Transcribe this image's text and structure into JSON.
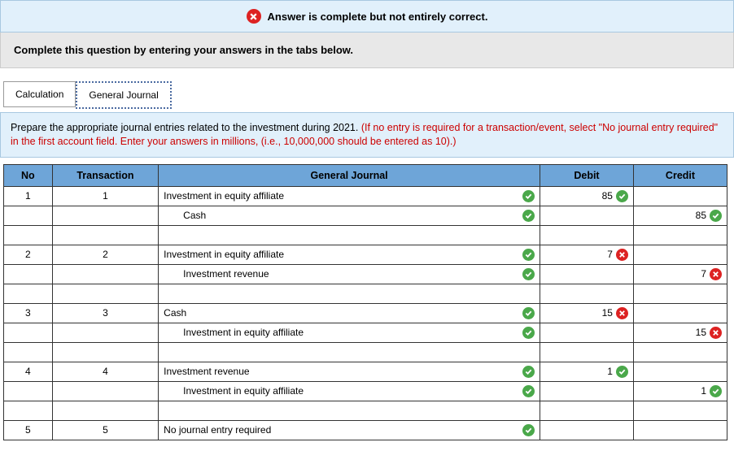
{
  "banner_text": "Answer is complete but not entirely correct.",
  "instruction": "Complete this question by entering your answers in the tabs below.",
  "tabs": {
    "calc": "Calculation",
    "gj": "General\nJournal"
  },
  "prompt_lead": "Prepare the appropriate journal entries related to the investment during 2021. ",
  "prompt_red": "(If no entry is required for a transaction/event, select \"No journal entry required\" in the first account field. Enter your answers in millions, (i.e., 10,000,000 should be entered as 10).)",
  "headers": {
    "no": "No",
    "txn": "Transaction",
    "gj": "General Journal",
    "debit": "Debit",
    "credit": "Credit"
  },
  "rows": [
    {
      "no": "1",
      "txn": "1",
      "acct": "Investment in equity affiliate",
      "indent": false,
      "acct_ok": true,
      "debit": "85",
      "debit_ok": true,
      "credit": "",
      "credit_ok": null
    },
    {
      "no": "",
      "txn": "",
      "acct": "Cash",
      "indent": true,
      "acct_ok": true,
      "debit": "",
      "debit_ok": null,
      "credit": "85",
      "credit_ok": true
    },
    {
      "spacer": true
    },
    {
      "no": "2",
      "txn": "2",
      "acct": "Investment in equity affiliate",
      "indent": false,
      "acct_ok": true,
      "debit": "7",
      "debit_ok": false,
      "credit": "",
      "credit_ok": null
    },
    {
      "no": "",
      "txn": "",
      "acct": "Investment revenue",
      "indent": true,
      "acct_ok": true,
      "debit": "",
      "debit_ok": null,
      "credit": "7",
      "credit_ok": false
    },
    {
      "spacer": true
    },
    {
      "no": "3",
      "txn": "3",
      "acct": "Cash",
      "indent": false,
      "acct_ok": true,
      "debit": "15",
      "debit_ok": false,
      "credit": "",
      "credit_ok": null
    },
    {
      "no": "",
      "txn": "",
      "acct": "Investment in equity affiliate",
      "indent": true,
      "acct_ok": true,
      "debit": "",
      "debit_ok": null,
      "credit": "15",
      "credit_ok": false
    },
    {
      "spacer": true
    },
    {
      "no": "4",
      "txn": "4",
      "acct": "Investment revenue",
      "indent": false,
      "acct_ok": true,
      "debit": "1",
      "debit_ok": true,
      "credit": "",
      "credit_ok": null
    },
    {
      "no": "",
      "txn": "",
      "acct": "Investment in equity affiliate",
      "indent": true,
      "acct_ok": true,
      "debit": "",
      "debit_ok": null,
      "credit": "1",
      "credit_ok": true
    },
    {
      "spacer": true
    },
    {
      "no": "5",
      "txn": "5",
      "acct": "No journal entry required",
      "indent": false,
      "acct_ok": true,
      "debit": "",
      "debit_ok": null,
      "credit": "",
      "credit_ok": null
    }
  ]
}
